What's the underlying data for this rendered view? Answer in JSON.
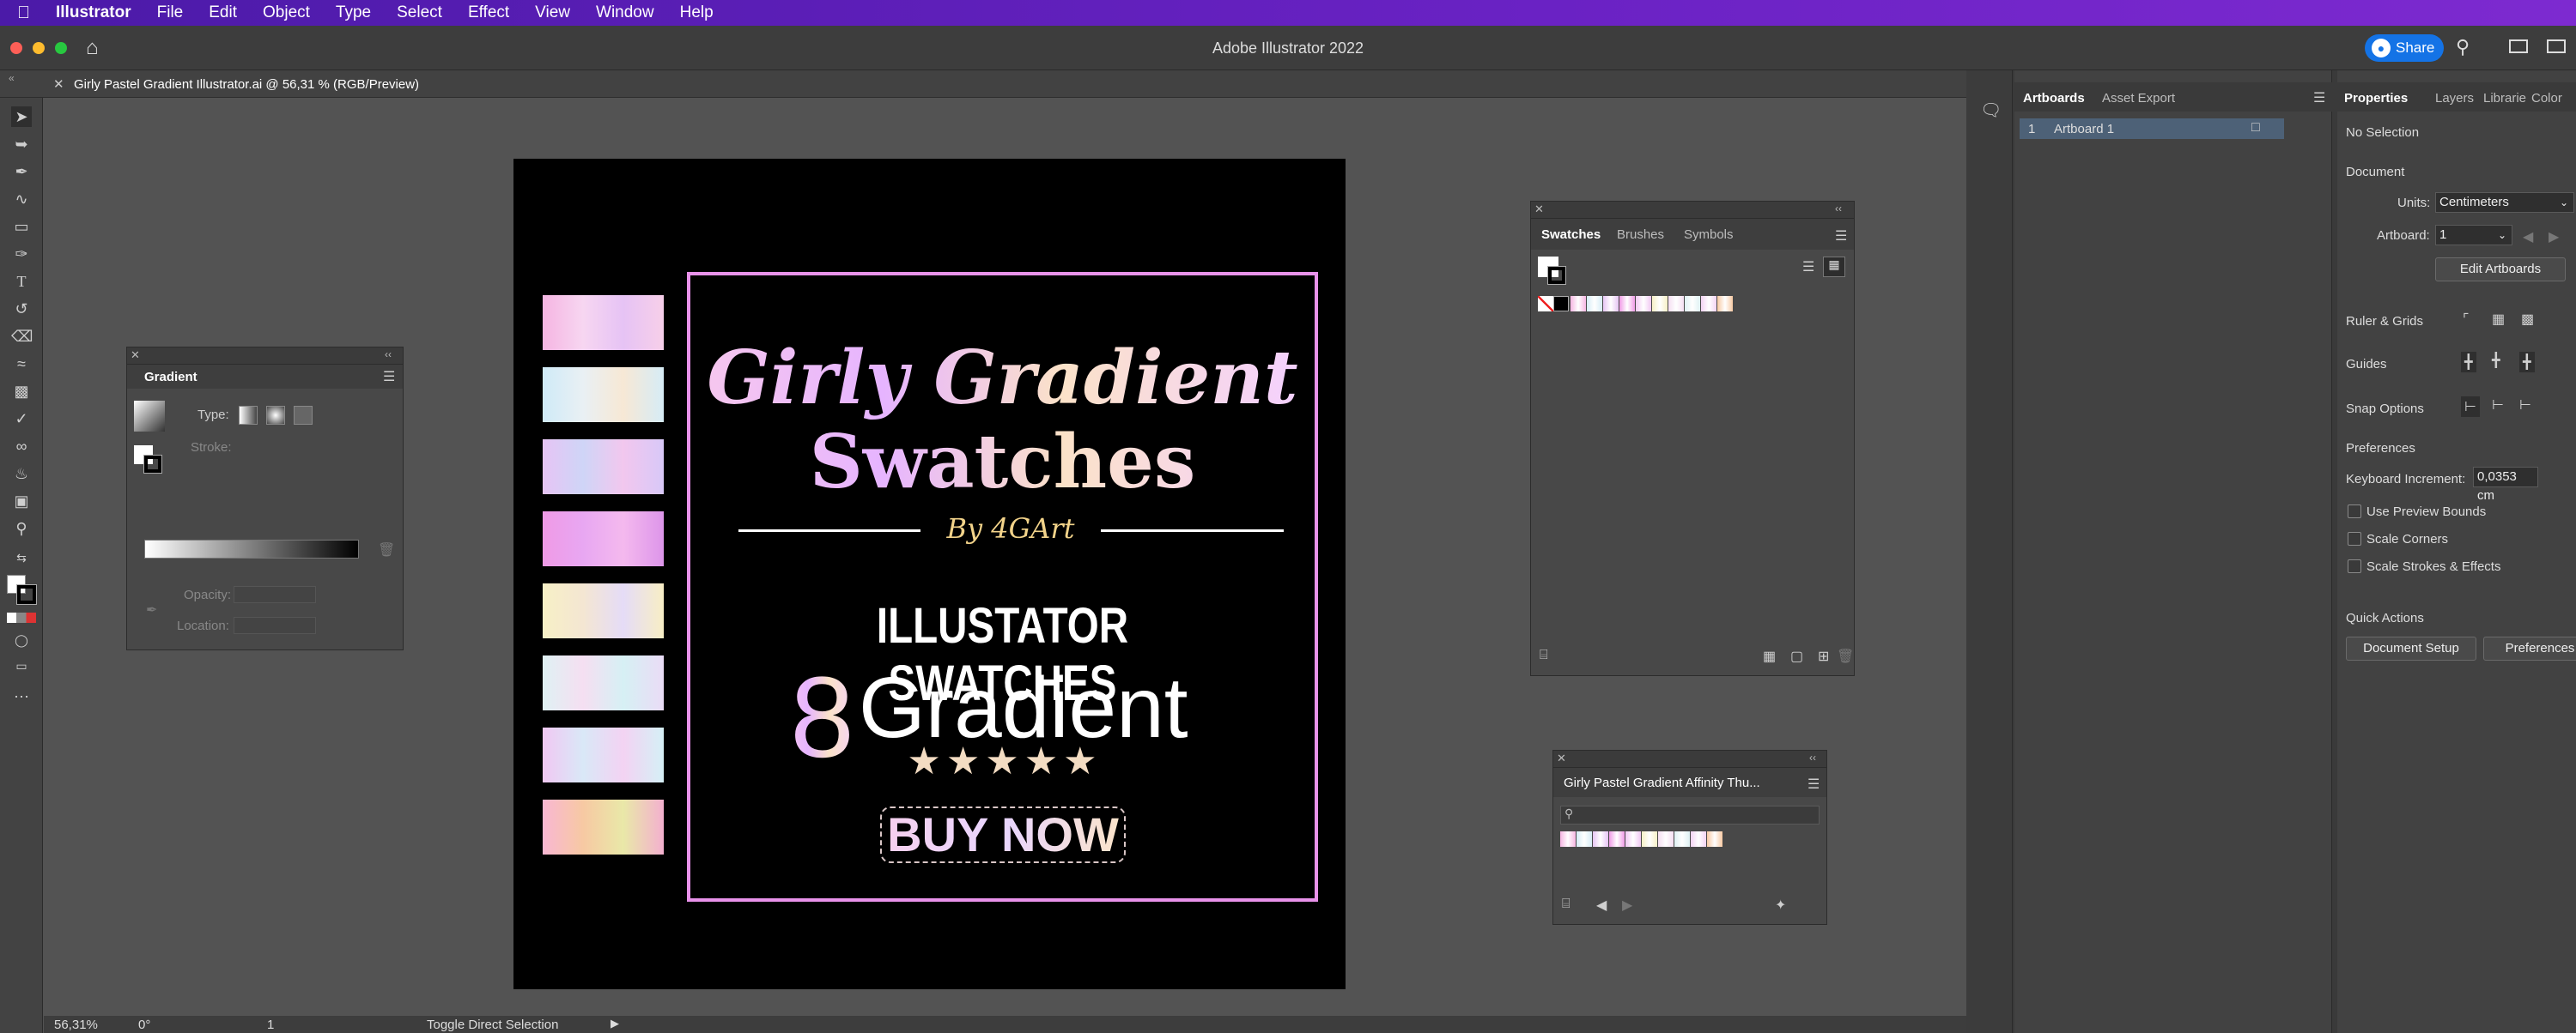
{
  "menubar": {
    "app": "Illustrator",
    "items": [
      "File",
      "Edit",
      "Object",
      "Type",
      "Select",
      "Effect",
      "View",
      "Window",
      "Help"
    ]
  },
  "titlebar": {
    "title": "Adobe Illustrator 2022",
    "share": "Share"
  },
  "document": {
    "tab": "Girly Pastel Gradient Illustrator.ai @ 56,31 % (RGB/Preview)"
  },
  "artboard": {
    "title_line1": "Girly Gradient",
    "title_line2": "Swatches",
    "byline": "By 4GArt",
    "subtitle": "ILLUSTATOR SWATCHES",
    "count": "8",
    "gradient_word": "Gradient",
    "stars": "★★★★★",
    "buy": "BUY NOW",
    "swatch_gradients": [
      [
        "#f5b5e2",
        "#f7d6f1",
        "#e6c3f5",
        "#f7cfe9"
      ],
      [
        "#cfeaf7",
        "#e9f0f4",
        "#f7e8d5",
        "#d6ecf6"
      ],
      [
        "#e6c4f4",
        "#cfd5f7",
        "#f2c7ee",
        "#d8c8f8"
      ],
      [
        "#ef9ae6",
        "#e8a7f2",
        "#f4b9ee",
        "#dd95ea"
      ],
      [
        "#f7f0c6",
        "#f4e6d2",
        "#e5dcf7",
        "#f8eec5"
      ],
      [
        "#dff1f3",
        "#f5dff2",
        "#d6f0f4",
        "#eadcf6"
      ],
      [
        "#f1c8f3",
        "#d9e8f7",
        "#f3d3f3",
        "#d5f0f6"
      ],
      [
        "#f9b7d3",
        "#f7c9a3",
        "#e9e8a8",
        "#f3b0cf"
      ]
    ],
    "frame_color": "#e892ea"
  },
  "gradient_panel": {
    "title": "Gradient",
    "type_label": "Type:",
    "stroke_label": "Stroke:",
    "opacity_label": "Opacity:",
    "location_label": "Location:"
  },
  "swatches_panel": {
    "tabs": [
      "Swatches",
      "Brushes",
      "Symbols"
    ],
    "chips": [
      "#f5b5e2",
      "#d6ecf6",
      "#e6c4f4",
      "#ef9ae6",
      "#f1c8f3",
      "#f7f0c6",
      "#f5dff2",
      "#dff1f3",
      "#f3d3f3",
      "#f7c9a3"
    ]
  },
  "library_panel": {
    "title": "Girly Pastel Gradient Affinity Thu...",
    "chips": [
      "#f5b5e2",
      "#d6ecf6",
      "#e6c4f4",
      "#ef9ae6",
      "#f1c8f3",
      "#f7f0c6",
      "#f5dff2",
      "#dff1f3",
      "#f3d3f3",
      "#f7c9a3"
    ]
  },
  "artboards_panel": {
    "tabs": [
      "Artboards",
      "Asset Export"
    ],
    "rows": [
      {
        "num": "1",
        "name": "Artboard 1"
      }
    ]
  },
  "properties": {
    "tabs": [
      "Properties",
      "Layers",
      "Librarie",
      "Color"
    ],
    "selection": "No Selection",
    "document_header": "Document",
    "units_label": "Units:",
    "units_value": "Centimeters",
    "artboard_label": "Artboard:",
    "artboard_value": "1",
    "edit_artboards": "Edit Artboards",
    "ruler_grids": "Ruler & Grids",
    "guides": "Guides",
    "snap_options": "Snap Options",
    "preferences_header": "Preferences",
    "keyboard_increment_label": "Keyboard Increment:",
    "keyboard_increment_value": "0,0353 cm",
    "use_preview_bounds": "Use Preview Bounds",
    "scale_corners": "Scale Corners",
    "scale_strokes": "Scale Strokes & Effects",
    "quick_actions": "Quick Actions",
    "document_setup": "Document Setup",
    "preferences_button": "Preferences"
  },
  "statusbar": {
    "zoom": "56,31%",
    "rotation": "0°",
    "artboard_num": "1",
    "tool_hint": "Toggle Direct Selection"
  }
}
